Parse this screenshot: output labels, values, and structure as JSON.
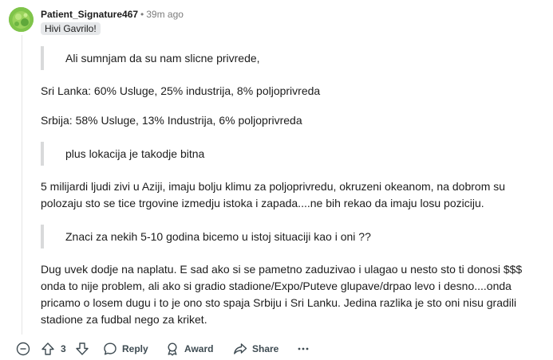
{
  "comment": {
    "username": "Patient_Signature467",
    "separator": "•",
    "time": "39m ago",
    "flair": "Hivi Gavrilo!",
    "blocks": [
      {
        "type": "quote",
        "text": "Ali sumnjam da su nam slicne privrede,"
      },
      {
        "type": "para",
        "text": "Sri Lanka: 60% Usluge, 25% industrija, 8% poljoprivreda"
      },
      {
        "type": "para",
        "text": "Srbija: 58% Usluge, 13% Industrija, 6% poljoprivreda"
      },
      {
        "type": "quote",
        "text": "plus lokacija je takodje bitna"
      },
      {
        "type": "para",
        "text": "5 milijardi ljudi zivi u Aziji, imaju bolju klimu za poljoprivredu, okruzeni okeanom, na dobrom su polozaju sto se tice trgovine izmedju istoka i zapada....ne bih rekao da imaju losu poziciju."
      },
      {
        "type": "quote",
        "text": "Znaci za nekih 5-10 godina bicemo u istoj situaciji kao i oni ??"
      },
      {
        "type": "para",
        "text": "Dug uvek dodje na naplatu. E sad ako si se pametno zaduzivao i ulagao u nesto sto ti donosi $$$ onda to nije problem, ali ako si gradio stadione/Expo/Puteve glupave/drpao levo i desno....onda pricamo o losem dugu i to je ono sto spaja Srbiju i Sri Lanku. Jedina razlika je sto oni nisu gradili stadione za fudbal nego za kriket."
      }
    ]
  },
  "actions": {
    "collapse_icon": "collapse-minus-icon",
    "upvote_icon": "upvote-arrow-icon",
    "vote_count": "3",
    "downvote_icon": "downvote-arrow-icon",
    "reply_icon": "speech-bubble-icon",
    "reply_label": "Reply",
    "award_icon": "award-ribbon-icon",
    "award_label": "Award",
    "share_icon": "share-arrow-icon",
    "share_label": "Share",
    "more_icon": "more-horizontal-icon"
  },
  "colors": {
    "quote_border": "#d9dadb",
    "flair_bg": "#e6e8ea",
    "meta_text": "#7c7c7c",
    "action_text": "#3e4b52"
  }
}
